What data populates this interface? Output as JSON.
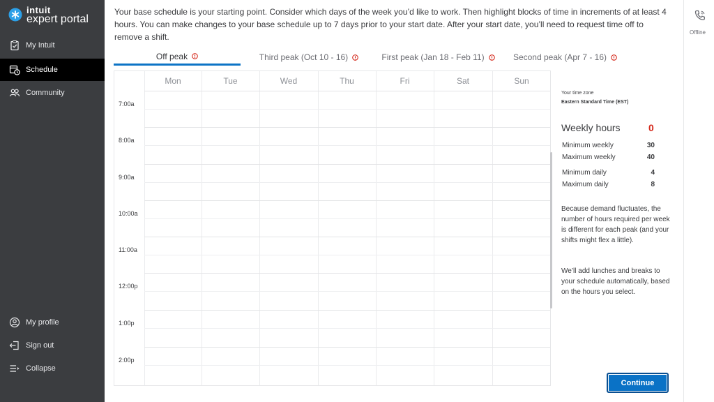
{
  "brand": {
    "line1": "intuit",
    "line2": "expert portal"
  },
  "sidebar": {
    "top_items": [
      {
        "label": "My Intuit",
        "icon": "clipboard-icon"
      },
      {
        "label": "Schedule",
        "icon": "calendar-clock-icon",
        "active": true
      },
      {
        "label": "Community",
        "icon": "people-icon"
      }
    ],
    "bottom_items": [
      {
        "label": "My profile",
        "icon": "user-circle-icon"
      },
      {
        "label": "Sign out",
        "icon": "sign-out-icon"
      },
      {
        "label": "Collapse",
        "icon": "collapse-icon"
      }
    ]
  },
  "intro": "Your base schedule is your starting point. Consider which days of the week you’d like to work. Then highlight blocks of time in increments of at least 4 hours. You can make changes to your base schedule up to 7 days prior to your start date. After your start date, you’ll need to request time off to remove a shift.",
  "tabs": [
    {
      "label": "Off peak",
      "active": true
    },
    {
      "label": "Third peak (Oct 10 - 16)"
    },
    {
      "label": "First peak (Jan 18 - Feb 11)"
    },
    {
      "label": "Second peak (Apr 7 - 16)"
    }
  ],
  "grid": {
    "days": [
      "Mon",
      "Tue",
      "Wed",
      "Thu",
      "Fri",
      "Sat",
      "Sun"
    ],
    "times": [
      "7:00a",
      "8:00a",
      "9:00a",
      "10:00a",
      "11:00a",
      "12:00p",
      "1:00p",
      "2:00p"
    ]
  },
  "info": {
    "tz_label": "Your time zone",
    "tz_value": "Eastern Standard Time (EST)",
    "weekly_hours_label": "Weekly hours",
    "weekly_hours_value": "0",
    "min_weekly_label": "Minimum weekly",
    "min_weekly_value": "30",
    "max_weekly_label": "Maximum weekly",
    "max_weekly_value": "40",
    "min_daily_label": "Minimum daily",
    "min_daily_value": "4",
    "max_daily_label": "Maximum daily",
    "max_daily_value": "8",
    "para1": "Because demand fluctuates, the number of hours required per week is different for each peak (and your shifts might flex a little).",
    "para2": "We’ll add lunches and breaks to your schedule automatically, based on the hours you select."
  },
  "continue_label": "Continue",
  "status": {
    "label": "Offline",
    "icon": "phone-icon"
  },
  "colors": {
    "sidebar_bg": "#3b3d40",
    "active_nav": "#000000",
    "accent": "#0a72c6",
    "warning": "#d52b1e"
  }
}
